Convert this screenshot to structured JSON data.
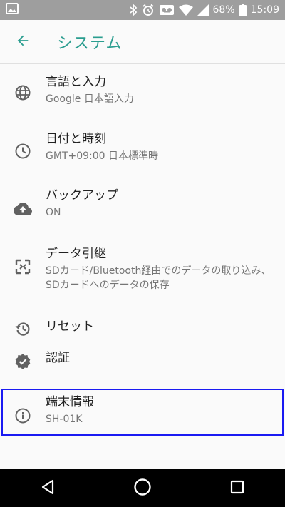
{
  "status_bar": {
    "battery": "68%",
    "time": "15:09"
  },
  "app_bar": {
    "title": "システム"
  },
  "items": [
    {
      "title": "言語と入力",
      "summary": "Google 日本語入力",
      "icon": "globe-icon"
    },
    {
      "title": "日付と時刻",
      "summary": "GMT+09:00 日本標準時",
      "icon": "clock-icon"
    },
    {
      "title": "バックアップ",
      "summary": "ON",
      "icon": "cloud-upload-icon"
    },
    {
      "title": "データ引継",
      "summary": "SDカード/Bluetooth経由でのデータの取り込み、SDカードへのデータの保存",
      "icon": "data-transfer-icon"
    },
    {
      "title": "リセット",
      "summary": "",
      "icon": "history-icon"
    },
    {
      "title": "認証",
      "summary": "",
      "icon": "verified-badge-icon"
    },
    {
      "title": "端末情報",
      "summary": "SH-01K",
      "icon": "info-icon"
    }
  ],
  "colors": {
    "accent": "#2a9d8f",
    "status_bar": "#9e9e9e",
    "highlight_border": "#1a1af2"
  }
}
